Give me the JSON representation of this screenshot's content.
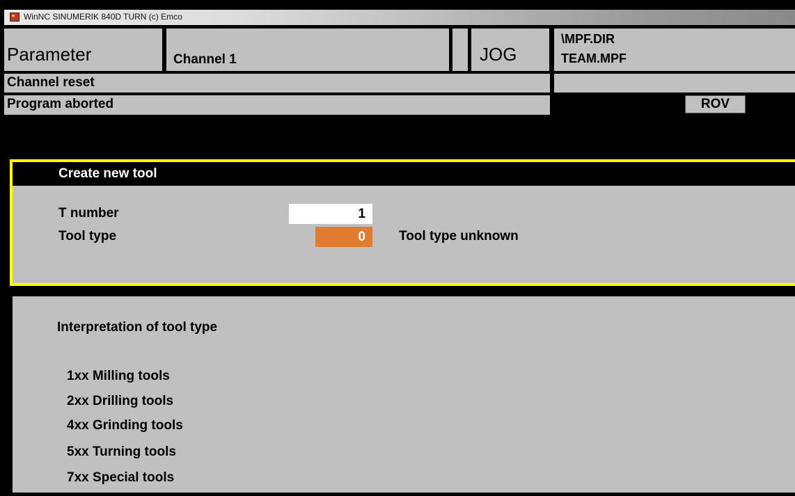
{
  "window": {
    "title": "WinNC SINUMERIK 840D TURN (c) Emco"
  },
  "header": {
    "area": "Parameter",
    "channel": "Channel 1",
    "mode": "JOG",
    "program_path": "\\MPF.DIR",
    "program_name": "TEAM.MPF"
  },
  "status": {
    "line1": "Channel reset",
    "line2": "Program aborted",
    "rov": "ROV"
  },
  "dialog": {
    "title": "Create new tool",
    "t_number_label": "T number",
    "t_number_value": "1",
    "tool_type_label": "Tool type",
    "tool_type_value": "0",
    "tool_type_description": "Tool type unknown",
    "colors": {
      "border": "#ffff00",
      "active_field": "#e07b30"
    }
  },
  "info": {
    "heading": "Interpretation of tool type",
    "items": [
      "1xx Milling tools",
      "2xx Drilling tools",
      "4xx Grinding tools",
      "5xx Turning tools",
      "7xx Special tools"
    ]
  }
}
